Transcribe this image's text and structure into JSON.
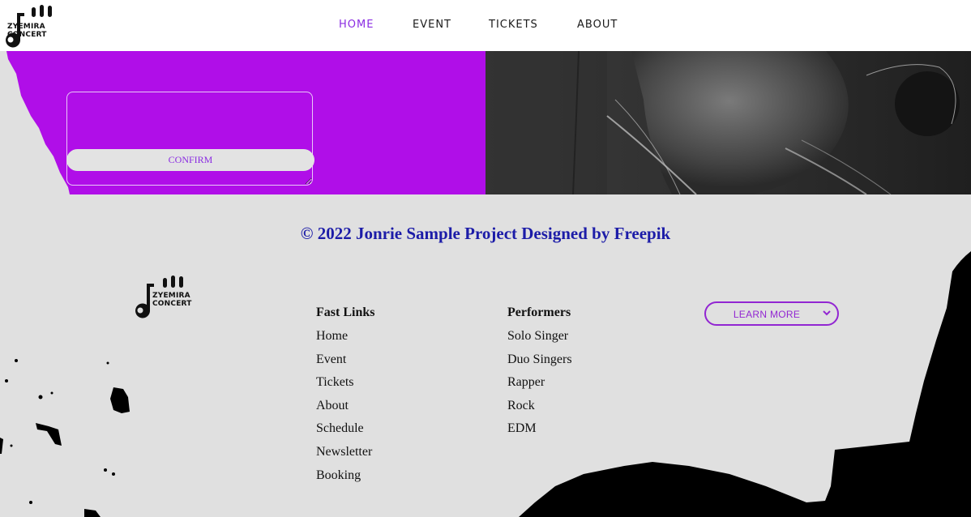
{
  "brand": {
    "line1": "ZYEMIRA",
    "line2": "CONCERT"
  },
  "nav": {
    "items": [
      {
        "label": "HOME",
        "active": true
      },
      {
        "label": "EVENT",
        "active": false
      },
      {
        "label": "TICKETS",
        "active": false
      },
      {
        "label": "ABOUT",
        "active": false
      }
    ]
  },
  "form": {
    "confirm_label": "CONFIRM",
    "message_value": ""
  },
  "footer": {
    "copyright": "© 2022 Jonrie Sample Project Designed by Freepik",
    "fast_links": {
      "title": "Fast Links",
      "items": [
        "Home",
        "Event",
        "Tickets",
        "About",
        "Schedule",
        "Newsletter",
        "Booking"
      ]
    },
    "performers": {
      "title": "Performers",
      "items": [
        "Solo Singer",
        "Duo Singers",
        "Rapper",
        "Rock",
        "EDM"
      ]
    },
    "learn_more": {
      "label": "LEARN MORE"
    }
  },
  "colors": {
    "accent": "#8a2be2",
    "purple_panel": "#b00ee8",
    "copyright_text": "#1c1ca8",
    "footer_bg": "#e0e0e0"
  },
  "icons": {
    "logo": "music-note-equalizer-icon",
    "dropdown": "chevron-down-icon"
  }
}
